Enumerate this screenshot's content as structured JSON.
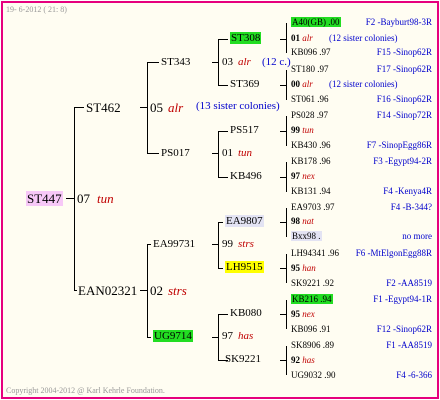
{
  "header": {
    "date": "19- 6-2012 ( 21: 8)"
  },
  "footer": {
    "copyright": "Copyright 2004-2012 @ Karl Kehrle Foundation."
  },
  "tree": {
    "root": {
      "name": "ST447",
      "num": "07",
      "tag": "tun"
    },
    "g2a": {
      "name": "ST462",
      "num": "05",
      "tag": "alr",
      "sisters": "(13 sister colonies)"
    },
    "g2b": {
      "name": "EAN02321",
      "num": "02",
      "tag": "strs"
    },
    "g3": [
      {
        "name": "ST343",
        "num": "03",
        "tag": "alr",
        "sisters": "(12 c.)"
      },
      {
        "name": "PS017",
        "num": "01",
        "tag": "tun"
      },
      {
        "name": "EA99731",
        "num": "99",
        "tag": "strs"
      },
      {
        "name": "UG9714",
        "num": "97",
        "tag": "has"
      }
    ],
    "g4": [
      "ST308",
      "ST369",
      "PS517",
      "KB496",
      "EA9807",
      "LH9515",
      "KB080",
      "SK9221"
    ],
    "g5": [
      {
        "line": "A40(GB) .00",
        "pedigree": "F2 -Bayburt98-3R"
      },
      {
        "line": "01 alr",
        "sisters": "(12 sister colonies)"
      },
      {
        "line": "KB096 .97",
        "pedigree": "F15 -Sinop62R"
      },
      {
        "line": "ST180 .97",
        "pedigree": "F17 -Sinop62R"
      },
      {
        "line": "00 alr",
        "sisters": "(12 sister colonies)"
      },
      {
        "line": "ST061 .96",
        "pedigree": "F16 -Sinop62R"
      },
      {
        "line": "PS028 .97",
        "pedigree": "F14 -Sinop72R"
      },
      {
        "line": "99 tun"
      },
      {
        "line": "KB430 .96",
        "pedigree": "F7 -SinopEgg86R"
      },
      {
        "line": "KB178 .96",
        "pedigree": "F3 -Egypt94-2R"
      },
      {
        "line": "97 nex"
      },
      {
        "line": "KB131 .94",
        "pedigree": "F4 -Kenya4R"
      },
      {
        "line": "EA9703 .97",
        "pedigree": "F4 -B-344?"
      },
      {
        "line": "98 nat"
      },
      {
        "line": "Bxx98 .",
        "pedigree": "no more"
      },
      {
        "line": "LH94341 .96",
        "pedigree": "F6 -MtElgonEgg88R"
      },
      {
        "line": "95 han"
      },
      {
        "line": "SK9221 .92",
        "pedigree": "F2 -AA8519"
      },
      {
        "line": "KB216 .94",
        "pedigree": "F1 -Egypt94-1R"
      },
      {
        "line": "95 nex"
      },
      {
        "line": "KB096 .91",
        "pedigree": "F12 -Sinop62R"
      },
      {
        "line": "SK8906 .89",
        "pedigree": "F1 -AA8519"
      },
      {
        "line": "92 has"
      },
      {
        "line": "UG9032 .90",
        "pedigree": "F4 -6-366"
      }
    ]
  }
}
